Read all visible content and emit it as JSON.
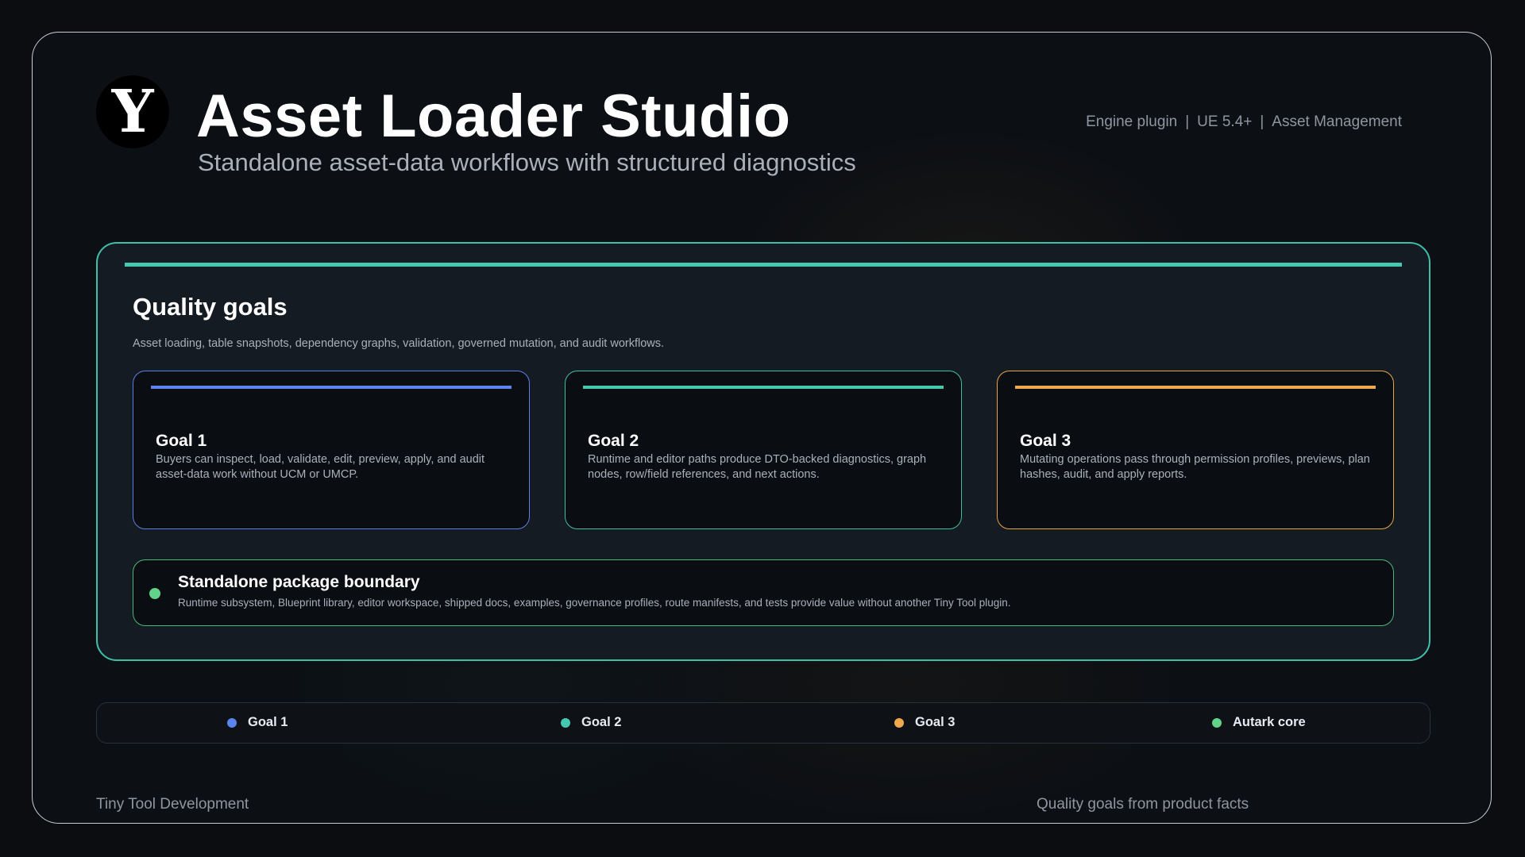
{
  "header": {
    "logo_letter": "Y",
    "title": "Asset Loader Studio",
    "subtitle": "Standalone asset-data workflows with structured diagnostics",
    "meta": [
      "Engine plugin",
      "UE 5.4+",
      "Asset Management"
    ],
    "meta_separator": "|"
  },
  "panel": {
    "title": "Quality goals",
    "description": "Asset loading, table snapshots, dependency graphs, validation, governed mutation, and audit workflows.",
    "goals": [
      {
        "title": "Goal 1",
        "text": "Buyers can inspect, load, validate, edit, preview, apply, and audit asset-data work without UCM or UMCP.",
        "color": "#5b84ee"
      },
      {
        "title": "Goal 2",
        "text": "Runtime and editor paths produce DTO-backed diagnostics, graph nodes, row/field references, and next actions.",
        "color": "#45c8b0"
      },
      {
        "title": "Goal 3",
        "text": "Mutating operations pass through permission profiles, previews, plan hashes, audit, and apply reports.",
        "color": "#efa84e"
      }
    ],
    "boundary": {
      "title": "Standalone package boundary",
      "text": "Runtime subsystem, Blueprint library, editor workspace, shipped docs, examples, governance profiles, route manifests, and tests provide value without another Tiny Tool plugin.",
      "color": "#62d38a"
    }
  },
  "legend": [
    {
      "label": "Goal 1",
      "color": "#5b84ee"
    },
    {
      "label": "Goal 2",
      "color": "#45c8b0"
    },
    {
      "label": "Goal 3",
      "color": "#efa84e"
    },
    {
      "label": "Autark core",
      "color": "#62d38a"
    }
  ],
  "footer": {
    "left": "Tiny Tool Development",
    "right": "Quality goals from product facts"
  }
}
